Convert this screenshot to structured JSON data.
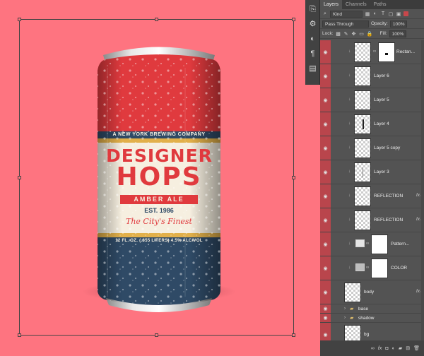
{
  "panel": {
    "tabs": [
      "Layers",
      "Channels",
      "Paths"
    ],
    "filter_label": "Kind",
    "blend_mode": "Pass Through",
    "opacity_label": "Opacity:",
    "opacity_value": "100%",
    "lock_label": "Lock:",
    "fill_label": "Fill:",
    "fill_value": "100%"
  },
  "layers": [
    {
      "name": "Rectan...",
      "type": "shape-mask"
    },
    {
      "name": "Layer 6",
      "type": "pixel"
    },
    {
      "name": "Layer 5",
      "type": "pixel"
    },
    {
      "name": "Layer 4",
      "type": "pixel"
    },
    {
      "name": "Layer 5 copy",
      "type": "pixel"
    },
    {
      "name": "Layer 3",
      "type": "pixel"
    },
    {
      "name": "REFLECTION",
      "type": "pixel",
      "fx": "fx"
    },
    {
      "name": "REFLECTION",
      "type": "pixel",
      "fx": "fx"
    },
    {
      "name": "Pattern...",
      "type": "fill"
    },
    {
      "name": "COLOR",
      "type": "fill"
    },
    {
      "name": "body",
      "type": "smart",
      "fx": "fx"
    },
    {
      "name": "base",
      "type": "group"
    },
    {
      "name": "shadow",
      "type": "group"
    },
    {
      "name": "bg",
      "type": "pixel"
    }
  ],
  "can": {
    "brand_top": "A NEW YORK BREWING COMPANY",
    "title_1": "DESIGNER",
    "title_2": "HOPS",
    "style": "AMBER ALE",
    "est": "EST. 1986",
    "tagline": "The City's Finest",
    "volume": "12 FL. OZ. (.355 LITERS) 4.5% ALC/VOL"
  },
  "colors": {
    "canvas_bg": "#fe7480",
    "can_red": "#e03a3e",
    "can_cream": "#f6efe0",
    "can_navy": "#2f4a66",
    "label_gold": "#e2b04a"
  },
  "icons": {
    "fx": "fx"
  }
}
